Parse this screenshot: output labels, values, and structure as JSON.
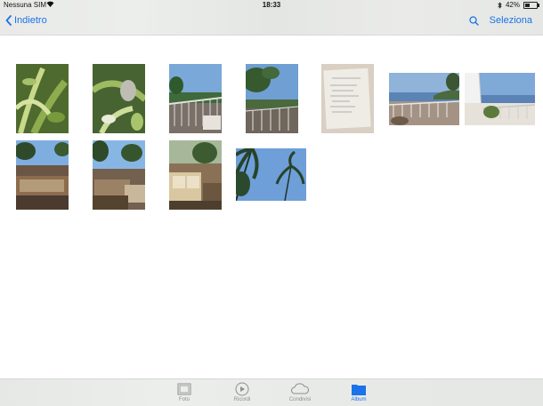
{
  "status_bar": {
    "carrier": "Nessuna SIM",
    "time": "18:33",
    "battery": "42%",
    "battery_level": 0.42
  },
  "nav": {
    "back_label": "Indietro",
    "select_label": "Seleziona",
    "accent_color": "#1a73e8"
  },
  "photos": [
    {
      "name": "photo-plant-leaves-1",
      "theme": "foliage"
    },
    {
      "name": "photo-plant-leaves-2",
      "theme": "foliage"
    },
    {
      "name": "photo-balcony-sea-1",
      "theme": "balcony"
    },
    {
      "name": "photo-balcony-sea-2",
      "theme": "balcony"
    },
    {
      "name": "photo-document-paper",
      "theme": "paper"
    },
    {
      "name": "photo-terrace-panorama-1",
      "theme": "panorama"
    },
    {
      "name": "photo-terrace-panorama-2",
      "theme": "panorama"
    },
    {
      "name": "photo-patio-table-1",
      "theme": "patio"
    },
    {
      "name": "photo-patio-table-2",
      "theme": "patio"
    },
    {
      "name": "photo-patio-sofa",
      "theme": "patio"
    },
    {
      "name": "photo-palm-trees-sky",
      "theme": "palms"
    }
  ],
  "tabs": [
    {
      "label": "Foto",
      "icon": "photos-icon",
      "active": false
    },
    {
      "label": "Ricordi",
      "icon": "memories-icon",
      "active": false
    },
    {
      "label": "Condivisi",
      "icon": "cloud-icon",
      "active": false
    },
    {
      "label": "Album",
      "icon": "folder-icon",
      "active": true
    }
  ]
}
